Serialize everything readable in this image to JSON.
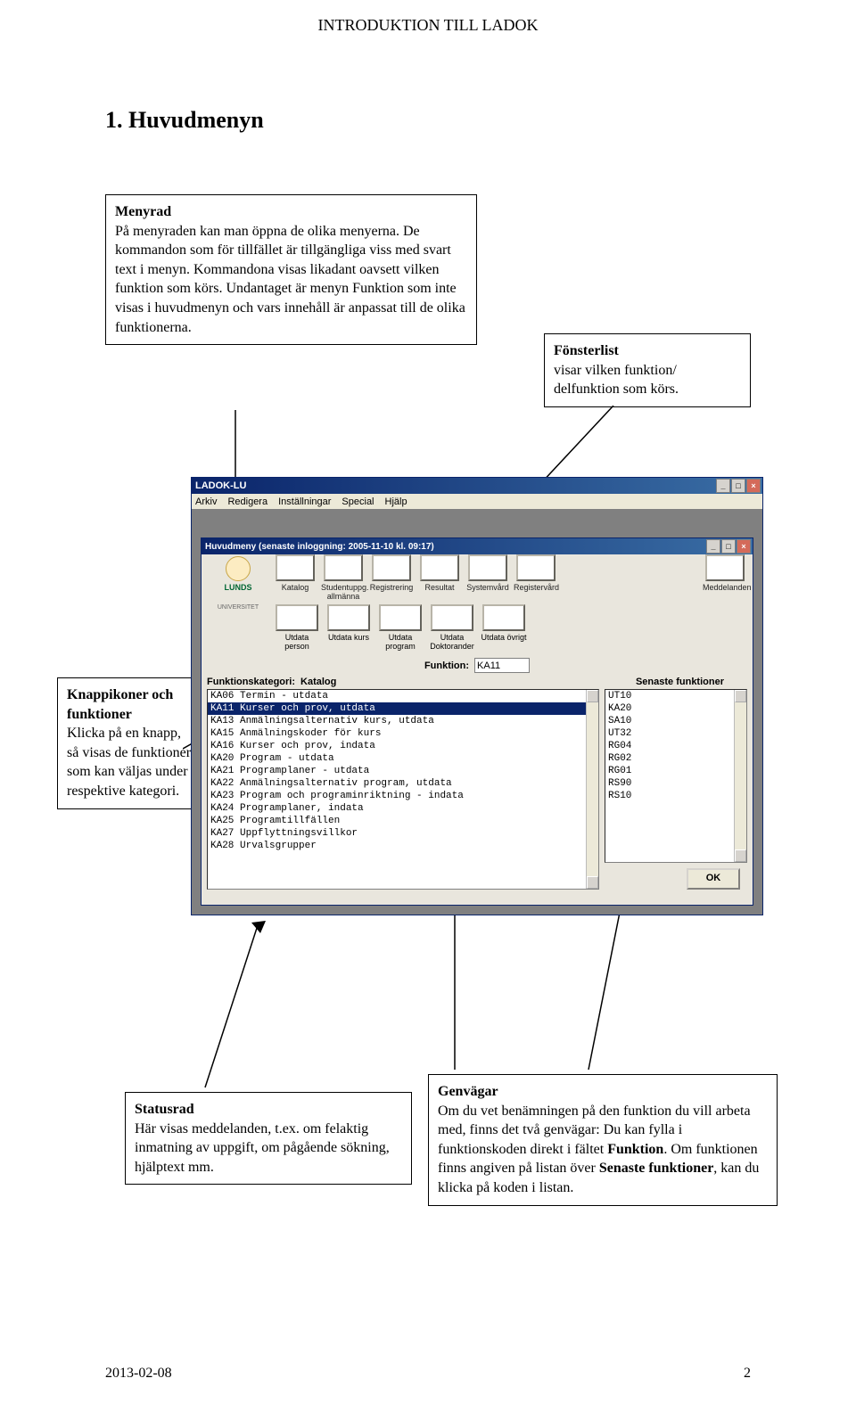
{
  "doc": {
    "title": "INTRODUKTION TILL LADOK",
    "section": "1. Huvudmenyn",
    "footer_date": "2013-02-08",
    "footer_page": "2"
  },
  "callouts": {
    "menyrad": {
      "title": "Menyrad",
      "body": "På menyraden kan man öppna de olika menyerna. De kommandon som för tillfället är tillgängliga viss med svart text i menyn. Kommandona visas likadant oavsett vilken funktion som körs. Undantaget är menyn Funktion som inte visas i huvudmenyn och vars innehåll är anpassat till de olika funktionerna."
    },
    "fonsterlist": {
      "title": "Fönsterlist",
      "body": "visar vilken funktion/ delfunktion som körs."
    },
    "knapp": {
      "title": "Knappikoner och funktioner",
      "body": "Klicka på en knapp, så visas de funktioner som kan väljas under respektive kategori."
    },
    "status": {
      "title": "Statusrad",
      "body": "Här visas meddelanden, t.ex. om felaktig inmatning av uppgift, om pågående sökning, hjälptext mm."
    },
    "genvagar": {
      "title": "Genvägar",
      "body_a": "Om du vet benämningen på den funktion du vill arbeta med, finns det två genvägar: Du kan fylla i funktionskoden direkt i fältet ",
      "body_b": "Funktion",
      "body_c": ". Om funktionen finns angiven på listan över ",
      "body_d": "Senaste funktioner",
      "body_e": ", kan du klicka på koden i listan."
    }
  },
  "app": {
    "outer_title": "LADOK-LU",
    "menubar": [
      "Arkiv",
      "Redigera",
      "Inställningar",
      "Special",
      "Hjälp"
    ],
    "inner_title": "Huvudmeny   (senaste inloggning:  2005-11-10 kl. 09:17)",
    "toolbar": [
      "Katalog",
      "Studentuppg. allmänna",
      "Registrering",
      "Resultat",
      "Systemvård",
      "Registervård",
      "Meddelanden"
    ],
    "lund": "LUNDS",
    "lund2": "UNIVERSITET",
    "toolbar2": [
      "Utdata person",
      "Utdata kurs",
      "Utdata program",
      "Utdata Doktorander",
      "Utdata övrigt"
    ],
    "funktion_label": "Funktion:",
    "funktion_value": "KA11",
    "kategori_label": "Funktionskategori:",
    "kategori_value": "Katalog",
    "func_list": [
      "KA06 Termin - utdata",
      "KA11 Kurser och prov, utdata",
      "KA13 Anmälningsalternativ kurs, utdata",
      "KA15 Anmälningskoder för kurs",
      "KA16 Kurser och prov, indata",
      "KA20 Program - utdata",
      "KA21 Programplaner - utdata",
      "KA22 Anmälningsalternativ program, utdata",
      "KA23 Program och programinriktning - indata",
      "KA24 Programplaner, indata",
      "KA25 Programtillfällen",
      "KA27 Uppflyttningsvillkor",
      "KA28 Urvalsgrupper"
    ],
    "func_selected_index": 1,
    "senaste_label": "Senaste funktioner",
    "senaste_list": [
      "UT10",
      "KA20",
      "SA10",
      "UT32",
      "RG04",
      "RG02",
      "RG01",
      "RS90",
      "RS10"
    ],
    "ok_label": "OK"
  }
}
